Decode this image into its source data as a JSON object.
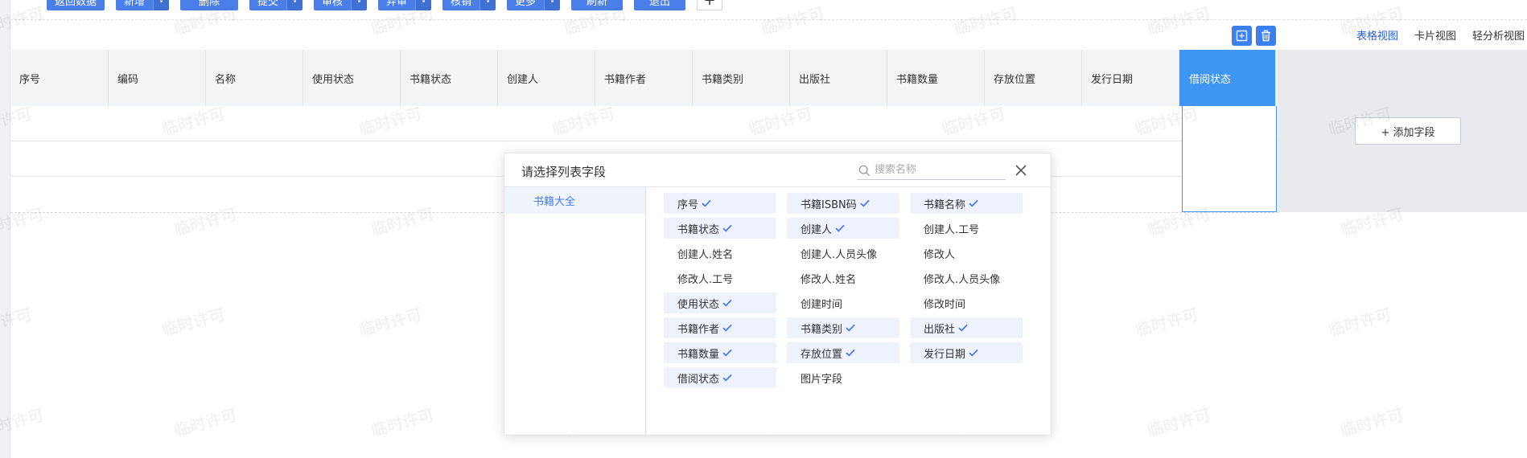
{
  "toolbar": {
    "buttons": [
      {
        "label": "返回数据",
        "width": 72,
        "caret": false
      },
      {
        "label": "新增",
        "width": 46,
        "caret": true
      },
      {
        "label": "删除",
        "width": 72,
        "caret": false
      },
      {
        "label": "提交",
        "width": 46,
        "caret": true
      },
      {
        "label": "审核",
        "width": 46,
        "caret": true
      },
      {
        "label": "弃审",
        "width": 46,
        "caret": true
      },
      {
        "label": "核销",
        "width": 46,
        "caret": true
      },
      {
        "label": "更多",
        "width": 46,
        "caret": true
      },
      {
        "label": "刷新",
        "width": 64,
        "caret": false
      },
      {
        "label": "退出",
        "width": 64,
        "caret": false
      }
    ],
    "plus_label": "+"
  },
  "view_tabs": {
    "table_view": "表格视图",
    "card_view": "卡片视图",
    "light_analysis_view": "轻分析视图"
  },
  "table": {
    "headers": [
      "序号",
      "编码",
      "名称",
      "使用状态",
      "书籍状态",
      "创建人",
      "书籍作者",
      "书籍类别",
      "出版社",
      "书籍数量",
      "存放位置",
      "发行日期"
    ],
    "active_header": "借阅状态",
    "add_field_label": "+ 添加字段"
  },
  "watermark_text": "临时许可",
  "popup": {
    "title": "请选择列表字段",
    "search_placeholder": "搜索名称",
    "category": "书籍大全",
    "fields": [
      {
        "label": "序号",
        "selected": true
      },
      {
        "label": "书籍ISBN码",
        "selected": true
      },
      {
        "label": "书籍名称",
        "selected": true
      },
      {
        "label": "书籍状态",
        "selected": true
      },
      {
        "label": "创建人",
        "selected": true
      },
      {
        "label": "创建人.工号",
        "selected": false
      },
      {
        "label": "创建人.姓名",
        "selected": false
      },
      {
        "label": "创建人.人员头像",
        "selected": false
      },
      {
        "label": "修改人",
        "selected": false
      },
      {
        "label": "修改人.工号",
        "selected": false
      },
      {
        "label": "修改人.姓名",
        "selected": false
      },
      {
        "label": "修改人.人员头像",
        "selected": false
      },
      {
        "label": "使用状态",
        "selected": true
      },
      {
        "label": "创建时间",
        "selected": false
      },
      {
        "label": "修改时间",
        "selected": false
      },
      {
        "label": "书籍作者",
        "selected": true
      },
      {
        "label": "书籍类别",
        "selected": true
      },
      {
        "label": "出版社",
        "selected": true
      },
      {
        "label": "书籍数量",
        "selected": true
      },
      {
        "label": "存放位置",
        "selected": true
      },
      {
        "label": "发行日期",
        "selected": true
      },
      {
        "label": "借阅状态",
        "selected": true
      },
      {
        "label": "图片字段",
        "selected": false
      }
    ]
  },
  "colors": {
    "primary": "#4a7ee8",
    "active_column": "#3f96f2",
    "header_bg": "#f3f4f6",
    "selected_field_bg": "#eef2fd"
  }
}
